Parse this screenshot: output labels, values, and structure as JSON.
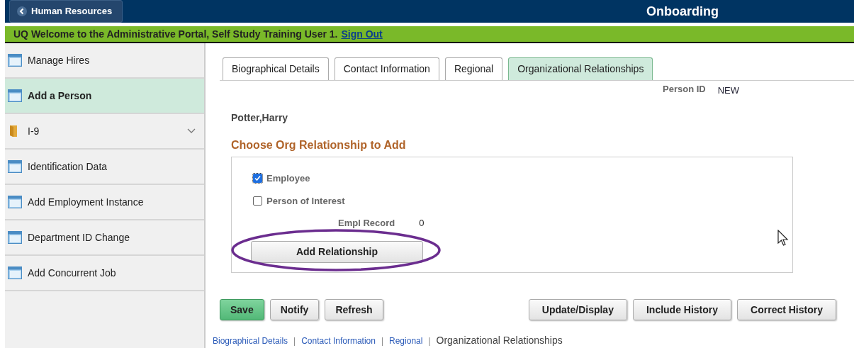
{
  "header": {
    "back_button": "Human Resources",
    "title": "Onboarding"
  },
  "welcome_bar": {
    "text": "UQ Welcome to the Administrative Portal, Self Study Training User 1.",
    "link": "Sign Out"
  },
  "sidebar": {
    "items": [
      {
        "label": "Manage Hires",
        "kind": "page",
        "selected": false
      },
      {
        "label": "Add a Person",
        "kind": "page",
        "selected": true
      },
      {
        "label": "I-9",
        "kind": "folder",
        "selected": false,
        "expanded": false
      },
      {
        "label": "Identification Data",
        "kind": "page",
        "selected": false
      },
      {
        "label": "Add Employment Instance",
        "kind": "page",
        "selected": false
      },
      {
        "label": "Department ID Change",
        "kind": "page",
        "selected": false
      },
      {
        "label": "Add Concurrent Job",
        "kind": "page",
        "selected": false
      }
    ]
  },
  "tabs": [
    {
      "label": "Biographical Details",
      "selected": false
    },
    {
      "label": "Contact Information",
      "selected": false
    },
    {
      "label": "Regional",
      "selected": false
    },
    {
      "label": "Organizational Relationships",
      "selected": true
    }
  ],
  "person_name": "Potter,Harry",
  "person_id": {
    "label": "Person ID",
    "value": "NEW"
  },
  "section_title": "Choose Org Relationship to Add",
  "options": [
    {
      "label": "Employee",
      "checked": true
    },
    {
      "label": "Person of Interest",
      "checked": false
    }
  ],
  "empl_record": {
    "label": "Empl Record",
    "value": "0"
  },
  "add_button": {
    "label": "Add Relationship",
    "circled": true
  },
  "mouse_pointer": {
    "shown": true
  },
  "buttons_left": [
    {
      "label": "Save",
      "primary": true
    },
    {
      "label": "Notify",
      "primary": false
    },
    {
      "label": "Refresh",
      "primary": false
    }
  ],
  "buttons_right": [
    "Update/Display",
    "Include History",
    "Correct History"
  ],
  "footer_links": [
    {
      "label": "Biographical Details",
      "selected": false,
      "separator": "|"
    },
    {
      "label": "Contact Information",
      "selected": false,
      "separator": "|"
    },
    {
      "label": "Regional",
      "selected": false,
      "separator": "|"
    },
    {
      "label": "Organizational Relationships",
      "selected": true
    }
  ]
}
